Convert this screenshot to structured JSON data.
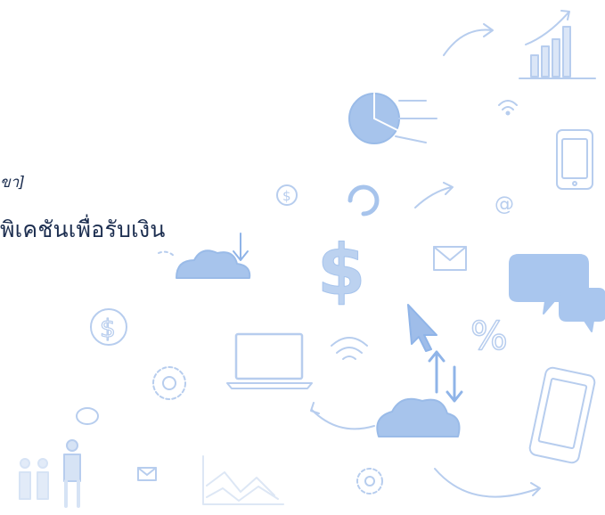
{
  "slide": {
    "caption": "ขา]",
    "title": "พิเคชันเพื่อรับเงิน"
  },
  "background": {
    "icons": [
      "trend-arrow-icon",
      "bar-chart-icon",
      "pie-chart-icon",
      "wifi-icon",
      "smartphone-icon",
      "dollar-coin-icon",
      "refresh-icon",
      "arrow-icon",
      "at-sign-icon",
      "cloud-icon",
      "dollar-sign-icon",
      "envelope-icon",
      "chat-bubble-icon",
      "cursor-arrow-icon",
      "percent-icon",
      "laptop-icon",
      "gear-icon",
      "people-icon",
      "line-chart-icon"
    ],
    "accent": "#8fb4e8"
  }
}
